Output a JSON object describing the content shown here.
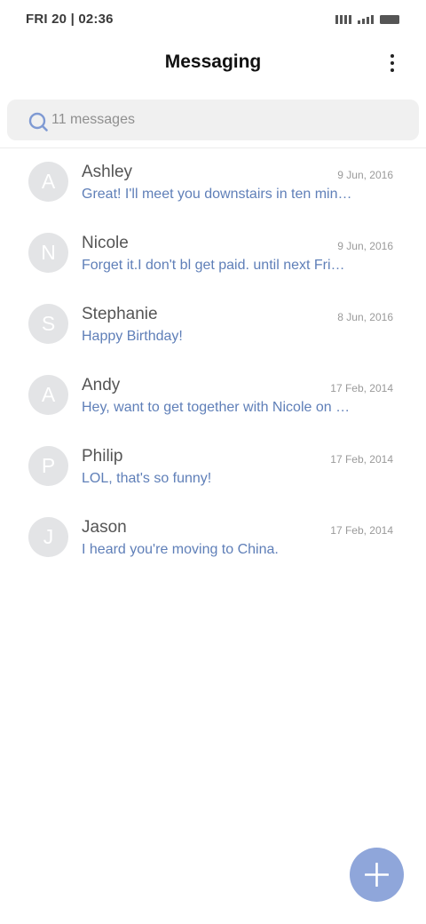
{
  "status_bar": {
    "time": "FRI 20 | 02:36",
    "icons": [
      "signal-bars-icon",
      "wifi-signal-icon",
      "battery-icon"
    ]
  },
  "header": {
    "title": "Messaging",
    "menu_icon": "more-vertical-icon"
  },
  "search": {
    "placeholder": "11 messages",
    "icon": "search-icon"
  },
  "conversations": [
    {
      "initial": "A",
      "name": "Ashley",
      "date": "9 Jun, 2016",
      "preview": "Great! I'll meet you downstairs in ten minutes."
    },
    {
      "initial": "N",
      "name": "Nicole",
      "date": "9 Jun, 2016",
      "preview": "Forget it.I don't bl get paid. until next Friday."
    },
    {
      "initial": "S",
      "name": "Stephanie",
      "date": "8 Jun, 2016",
      "preview": "Happy Birthday!"
    },
    {
      "initial": "A",
      "name": "Andy",
      "date": "17 Feb, 2014",
      "preview": "Hey, want to get together with Nicole on Friday?"
    },
    {
      "initial": "P",
      "name": "Philip",
      "date": "17 Feb, 2014",
      "preview": "LOL, that's so funny!"
    },
    {
      "initial": "J",
      "name": "Jason",
      "date": "17 Feb, 2014",
      "preview": "I heard you're moving to China."
    }
  ],
  "fab": {
    "icon": "plus-icon",
    "color": "#8fa6da"
  },
  "colors": {
    "accent": "#8fa6da",
    "preview_text": "#5f7fb8",
    "avatar_bg": "#e3e4e6"
  }
}
